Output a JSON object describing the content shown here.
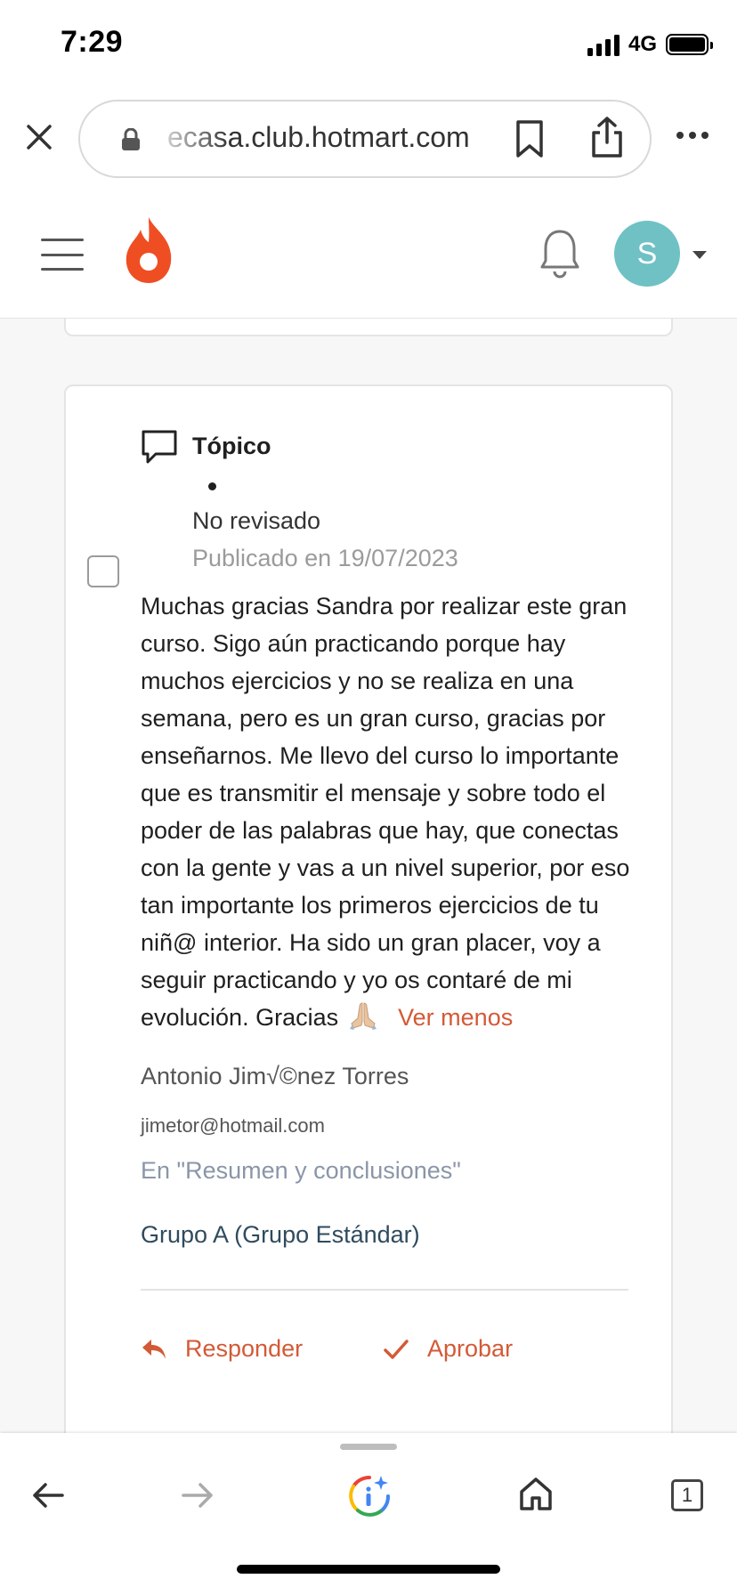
{
  "status_bar": {
    "time": "7:29",
    "network": "4G"
  },
  "browser": {
    "url": "ecasa.club.hotmart.com",
    "open_tabs": "1"
  },
  "header": {
    "avatar_initial": "S"
  },
  "post": {
    "type_label": "Tópico",
    "status": "No revisado",
    "published": "Publicado en 19/07/2023",
    "body": "Muchas gracias Sandra por realizar este gran curso. Sigo aún practicando porque hay muchos ejercicios y no se realiza en una semana, pero es un gran curso, gracias por enseñarnos. Me llevo del curso lo importante que es transmitir el mensaje y sobre todo el poder de las palabras que hay, que conectas con la gente y vas a un nivel superior, por eso tan importante los primeros ejercicios de tu niñ@ interior. Ha sido un gran placer, voy a seguir practicando y yo os contaré de mi evolución. Gracias",
    "toggle_label": "Ver menos",
    "author": "Antonio Jim√©nez Torres",
    "email": "jimetor@hotmail.com",
    "location": "En \"Resumen y conclusiones\"",
    "group": "Grupo A (Grupo Estándar)",
    "reply_label": "Responder",
    "approve_label": "Aprobar"
  },
  "colors": {
    "brand": "#ef4e23",
    "accent_link": "#d35a36",
    "avatar": "#6fc1c4",
    "group_text": "#2f4b5e"
  }
}
